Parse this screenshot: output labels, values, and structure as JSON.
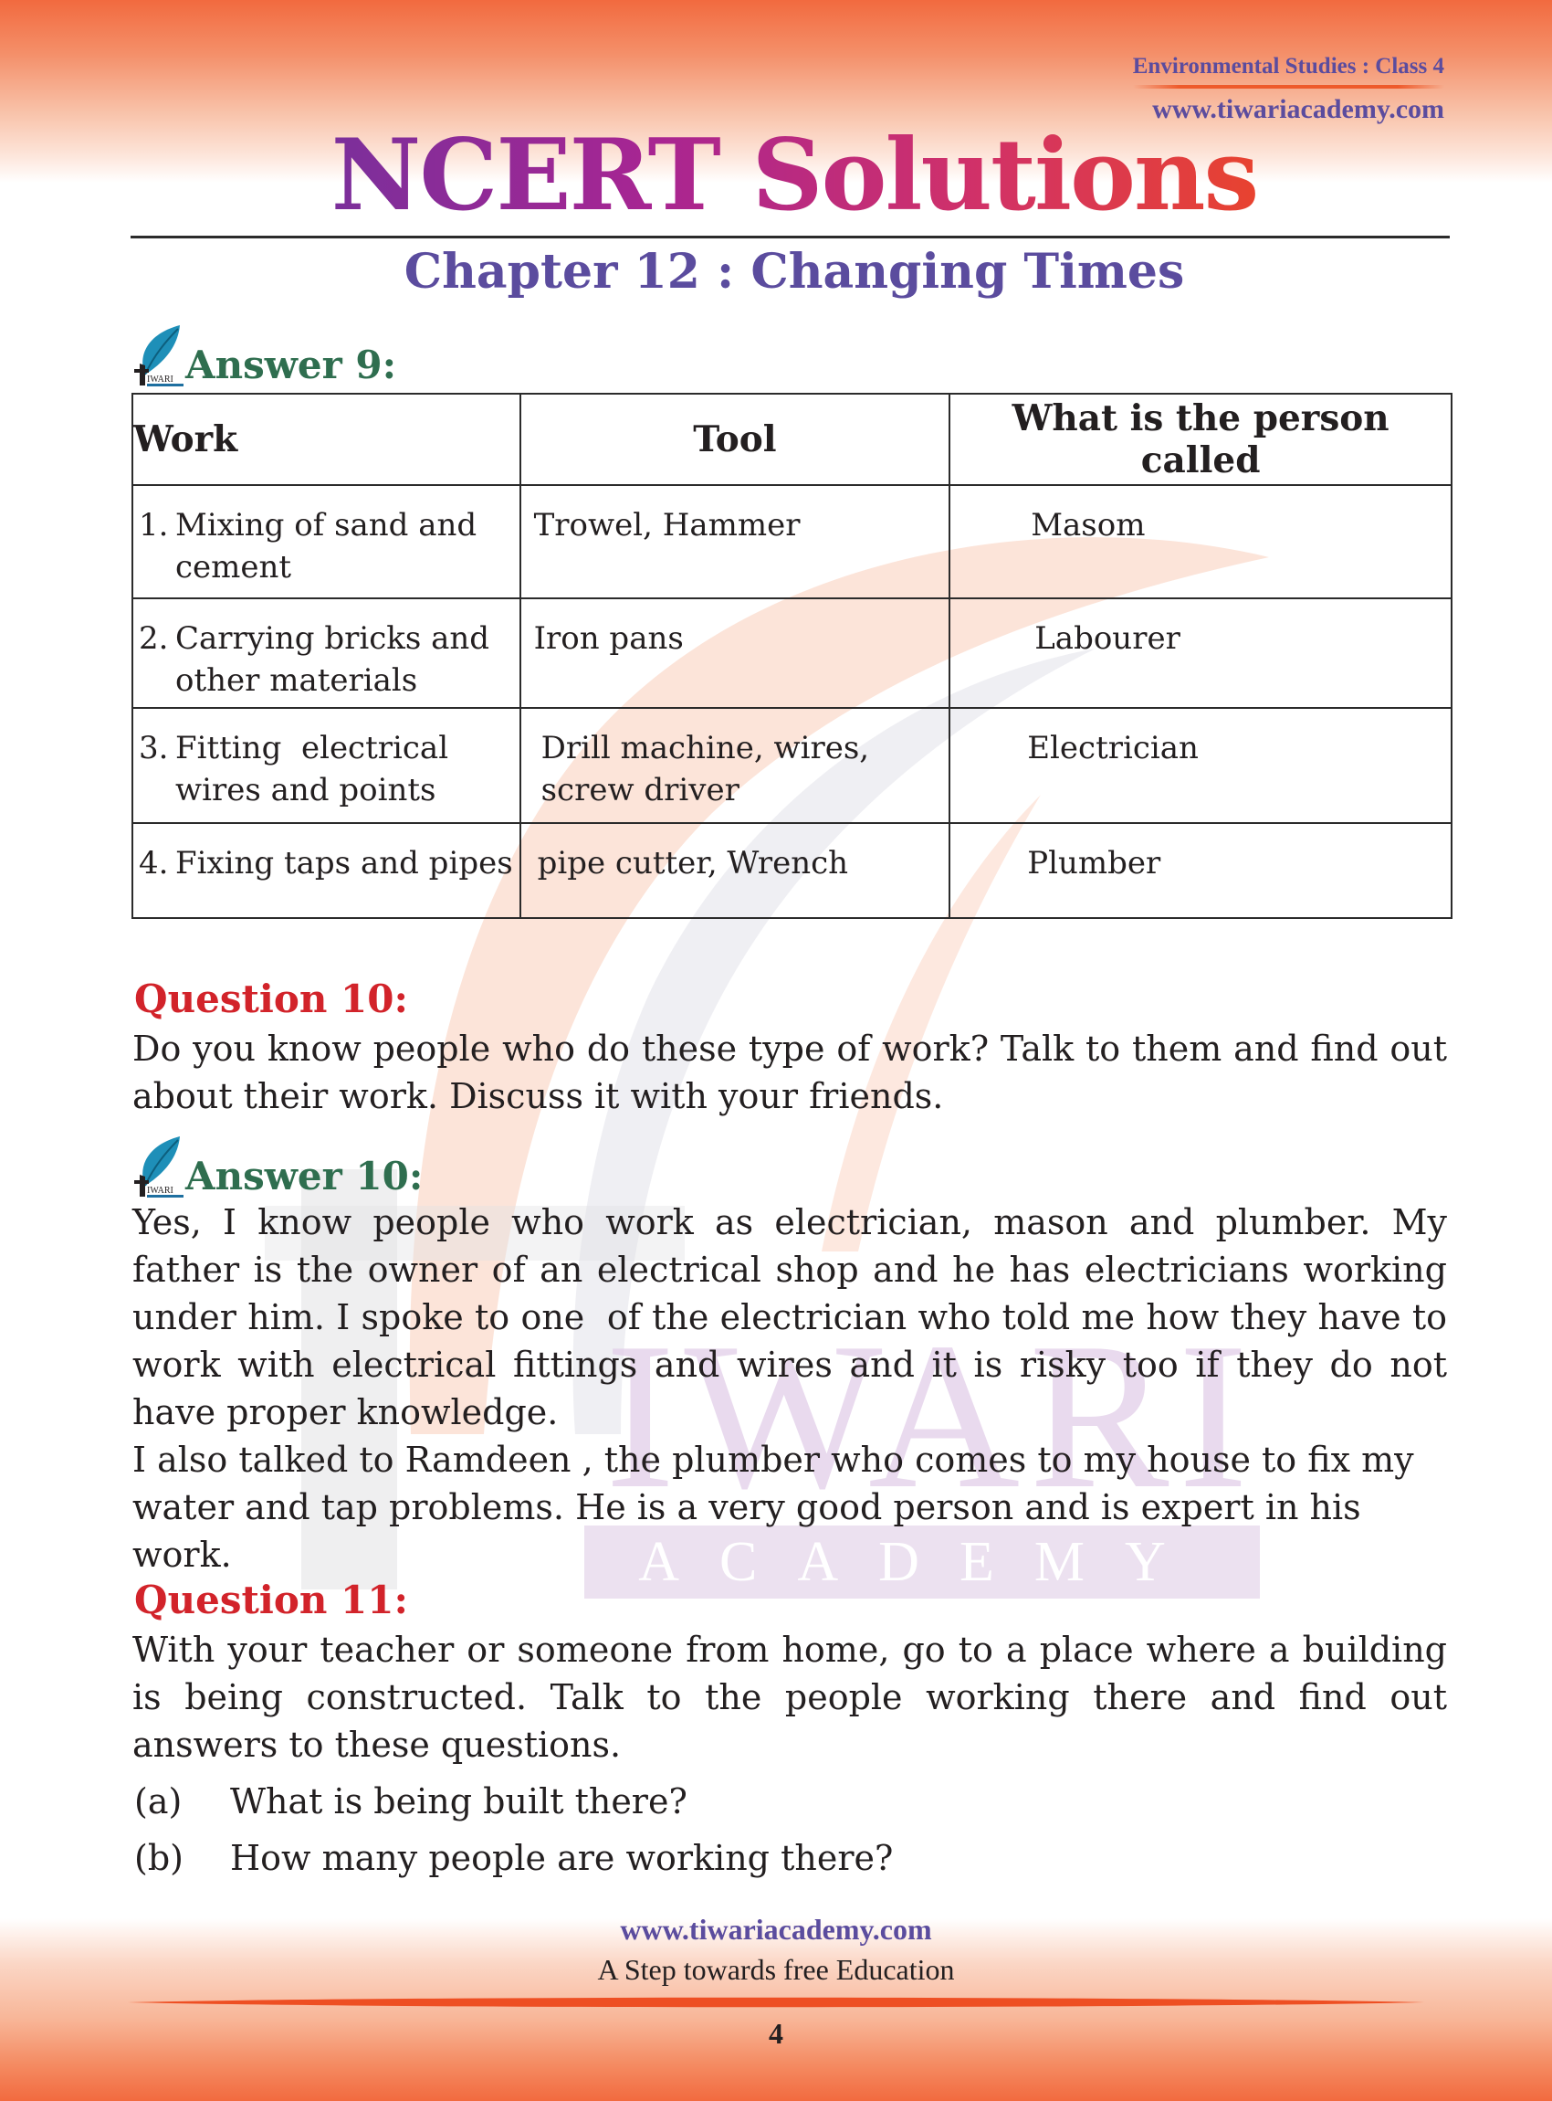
{
  "header": {
    "subject": "Environmental Studies : Class 4",
    "website": "www.tiwariacademy.com",
    "title": "NCERT Solutions",
    "chapter": "Chapter 12 : Changing Times"
  },
  "colors": {
    "accent_purple": "#5b4c9e",
    "question_red": "#d2232a",
    "answer_green": "#2f6e4f",
    "band_orange": "#f26a3f"
  },
  "watermark": {
    "brand_big": "IWARI",
    "brand_small": "ACADEMY"
  },
  "logo": {
    "icon": "tiwari-leaf-logo-icon",
    "text": "IWARI"
  },
  "answer9": {
    "label": "Answer 9:",
    "table": {
      "headers": [
        "Work",
        "Tool",
        "What is the person called"
      ],
      "rows": [
        {
          "num": "1.",
          "work": "Mixing of sand and cement",
          "tool": "Trowel, Hammer",
          "person": "Masom"
        },
        {
          "num": "2.",
          "work": "Carrying bricks and other materials",
          "tool": "Iron pans",
          "person": "Labourer"
        },
        {
          "num": "3.",
          "work": "Fitting  electrical wires and points",
          "tool": "Drill machine, wires, screw driver",
          "person": "Electrician"
        },
        {
          "num": "4.",
          "work": "Fixing taps and pipes",
          "tool": "pipe cutter, Wrench",
          "person": "Plumber"
        }
      ]
    }
  },
  "question10": {
    "label": "Question 10:",
    "text": "Do you know people who do these type of work? Talk to them and find out about their work. Discuss it with your friends."
  },
  "answer10": {
    "label": "Answer 10:",
    "paragraphs": [
      "Yes, I know people who work as electrician, mason and plumber. My father is the owner of an electrical shop and he has electricians working under him. I spoke to one  of the electrician who told me how they have to work with electrical fittings and wires and it is risky too if they do not have proper knowledge.",
      "I also talked to Ramdeen , the plumber who comes to my house to fix my water and tap problems. He is a very good person and is expert in his work."
    ]
  },
  "question11": {
    "label": "Question 11:",
    "text": "With your teacher or someone from home, go to a place where a building is being constructed. Talk to the people working there and find out answers to these questions.",
    "items": [
      {
        "marker": "(a)",
        "text": "What is being built there?"
      },
      {
        "marker": "(b)",
        "text": "How many people are working there?"
      }
    ]
  },
  "footer": {
    "website": "www.tiwariacademy.com",
    "tagline": "A Step towards free Education",
    "page_number": "4"
  }
}
